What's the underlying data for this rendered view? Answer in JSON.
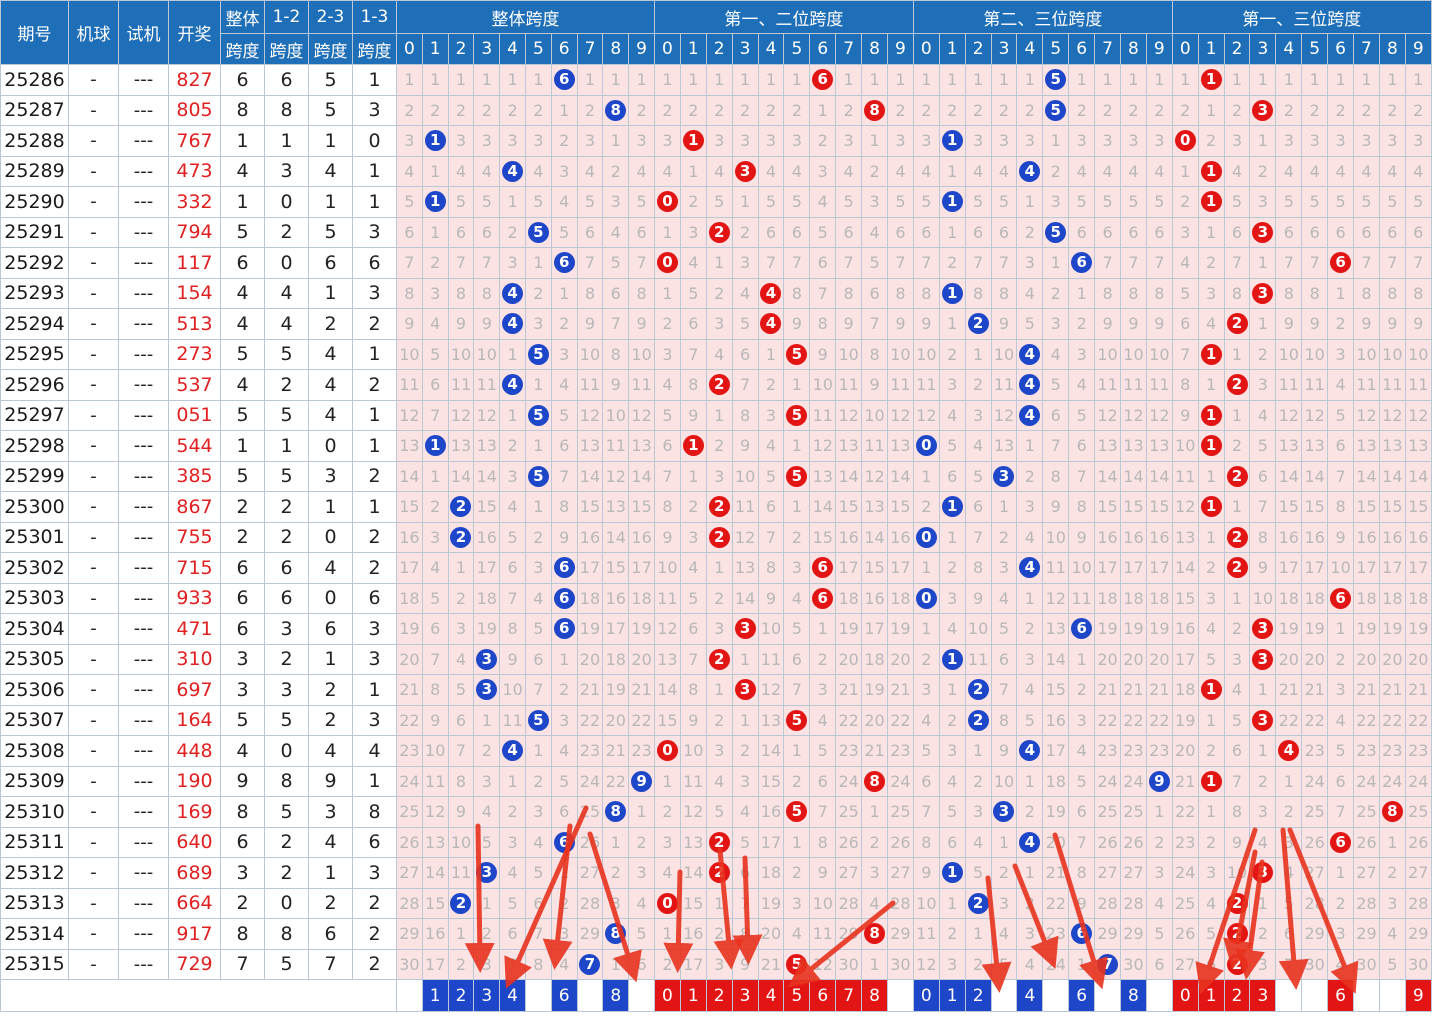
{
  "headers": {
    "period": "期号",
    "machine": "机球",
    "trial": "试机",
    "draw": "开奖",
    "span_total": [
      "整体",
      "跨度"
    ],
    "span_12": [
      "1-2",
      "跨度"
    ],
    "span_23": [
      "2-3",
      "跨度"
    ],
    "span_13": [
      "1-3",
      "跨度"
    ],
    "groups": [
      "整体跨度",
      "第一、二位跨度",
      "第二、三位跨度",
      "第一、三位跨度"
    ],
    "digits": [
      "0",
      "1",
      "2",
      "3",
      "4",
      "5",
      "6",
      "7",
      "8",
      "9"
    ]
  },
  "rows": [
    {
      "period": "25286",
      "machine": "-",
      "trial": "---",
      "draw": "827",
      "s": [
        6,
        6,
        5,
        1
      ]
    },
    {
      "period": "25287",
      "machine": "-",
      "trial": "---",
      "draw": "805",
      "s": [
        8,
        8,
        5,
        3
      ]
    },
    {
      "period": "25288",
      "machine": "-",
      "trial": "---",
      "draw": "767",
      "s": [
        1,
        1,
        1,
        0
      ]
    },
    {
      "period": "25289",
      "machine": "-",
      "trial": "---",
      "draw": "473",
      "s": [
        4,
        3,
        4,
        1
      ]
    },
    {
      "period": "25290",
      "machine": "-",
      "trial": "---",
      "draw": "332",
      "s": [
        1,
        0,
        1,
        1
      ]
    },
    {
      "period": "25291",
      "machine": "-",
      "trial": "---",
      "draw": "794",
      "s": [
        5,
        2,
        5,
        3
      ]
    },
    {
      "period": "25292",
      "machine": "-",
      "trial": "---",
      "draw": "117",
      "s": [
        6,
        0,
        6,
        6
      ]
    },
    {
      "period": "25293",
      "machine": "-",
      "trial": "---",
      "draw": "154",
      "s": [
        4,
        4,
        1,
        3
      ]
    },
    {
      "period": "25294",
      "machine": "-",
      "trial": "---",
      "draw": "513",
      "s": [
        4,
        4,
        2,
        2
      ]
    },
    {
      "period": "25295",
      "machine": "-",
      "trial": "---",
      "draw": "273",
      "s": [
        5,
        5,
        4,
        1
      ]
    },
    {
      "period": "25296",
      "machine": "-",
      "trial": "---",
      "draw": "537",
      "s": [
        4,
        2,
        4,
        2
      ]
    },
    {
      "period": "25297",
      "machine": "-",
      "trial": "---",
      "draw": "051",
      "s": [
        5,
        5,
        4,
        1
      ]
    },
    {
      "period": "25298",
      "machine": "-",
      "trial": "---",
      "draw": "544",
      "s": [
        1,
        1,
        0,
        1
      ]
    },
    {
      "period": "25299",
      "machine": "-",
      "trial": "---",
      "draw": "385",
      "s": [
        5,
        5,
        3,
        2
      ]
    },
    {
      "period": "25300",
      "machine": "-",
      "trial": "---",
      "draw": "867",
      "s": [
        2,
        2,
        1,
        1
      ]
    },
    {
      "period": "25301",
      "machine": "-",
      "trial": "---",
      "draw": "755",
      "s": [
        2,
        2,
        0,
        2
      ]
    },
    {
      "period": "25302",
      "machine": "-",
      "trial": "---",
      "draw": "715",
      "s": [
        6,
        6,
        4,
        2
      ]
    },
    {
      "period": "25303",
      "machine": "-",
      "trial": "---",
      "draw": "933",
      "s": [
        6,
        6,
        0,
        6
      ]
    },
    {
      "period": "25304",
      "machine": "-",
      "trial": "---",
      "draw": "471",
      "s": [
        6,
        3,
        6,
        3
      ]
    },
    {
      "period": "25305",
      "machine": "-",
      "trial": "---",
      "draw": "310",
      "s": [
        3,
        2,
        1,
        3
      ]
    },
    {
      "period": "25306",
      "machine": "-",
      "trial": "---",
      "draw": "697",
      "s": [
        3,
        3,
        2,
        1
      ]
    },
    {
      "period": "25307",
      "machine": "-",
      "trial": "---",
      "draw": "164",
      "s": [
        5,
        5,
        2,
        3
      ]
    },
    {
      "period": "25308",
      "machine": "-",
      "trial": "---",
      "draw": "448",
      "s": [
        4,
        0,
        4,
        4
      ]
    },
    {
      "period": "25309",
      "machine": "-",
      "trial": "---",
      "draw": "190",
      "s": [
        9,
        8,
        9,
        1
      ]
    },
    {
      "period": "25310",
      "machine": "-",
      "trial": "---",
      "draw": "169",
      "s": [
        8,
        5,
        3,
        8
      ]
    },
    {
      "period": "25311",
      "machine": "-",
      "trial": "---",
      "draw": "640",
      "s": [
        6,
        2,
        4,
        6
      ]
    },
    {
      "period": "25312",
      "machine": "-",
      "trial": "---",
      "draw": "689",
      "s": [
        3,
        2,
        1,
        3
      ]
    },
    {
      "period": "25313",
      "machine": "-",
      "trial": "---",
      "draw": "664",
      "s": [
        2,
        0,
        2,
        2
      ]
    },
    {
      "period": "25314",
      "machine": "-",
      "trial": "---",
      "draw": "917",
      "s": [
        8,
        8,
        6,
        2
      ]
    },
    {
      "period": "25315",
      "machine": "-",
      "trial": "---",
      "draw": "729",
      "s": [
        7,
        5,
        7,
        2
      ]
    }
  ],
  "summary": [
    [
      "",
      "1",
      "2",
      "3",
      "4",
      "",
      "6",
      "",
      "8",
      ""
    ],
    [
      "0",
      "1",
      "2",
      "3",
      "4",
      "5",
      "6",
      "7",
      "8",
      ""
    ],
    [
      "0",
      "1",
      "2",
      "",
      "4",
      "",
      "6",
      "",
      "8",
      ""
    ],
    [
      "0",
      "1",
      "2",
      "3",
      "",
      "",
      "6",
      "",
      "",
      "9"
    ]
  ],
  "colors": {
    "blue": "#1e46c8",
    "red": "#e31414",
    "header": "#1f6fb8",
    "arrow": "#e8321e"
  }
}
